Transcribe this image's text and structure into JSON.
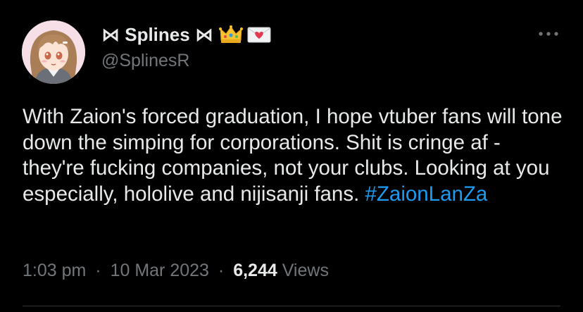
{
  "author": {
    "display_name": "⋈ Splines ⋈",
    "handle": "@SplinesR",
    "name_emojis": [
      "crown-icon",
      "love-letter-icon"
    ]
  },
  "tweet": {
    "text": "With Zaion's forced graduation, I hope vtuber fans will tone down the simping for corporations. Shit is cringe af - they're fucking companies, not your clubs. Looking at you especially, hololive and nijisanji fans. ",
    "hashtag": "#ZaionLanZa"
  },
  "meta": {
    "time": "1:03 pm",
    "separator": "·",
    "date": "10 Mar 2023",
    "views_count": "6,244",
    "views_label": "Views"
  },
  "colors": {
    "background": "#000000",
    "text_primary": "#e7e9ea",
    "text_secondary": "#71767b",
    "link": "#1d9bf0",
    "divider": "#2f3336"
  }
}
